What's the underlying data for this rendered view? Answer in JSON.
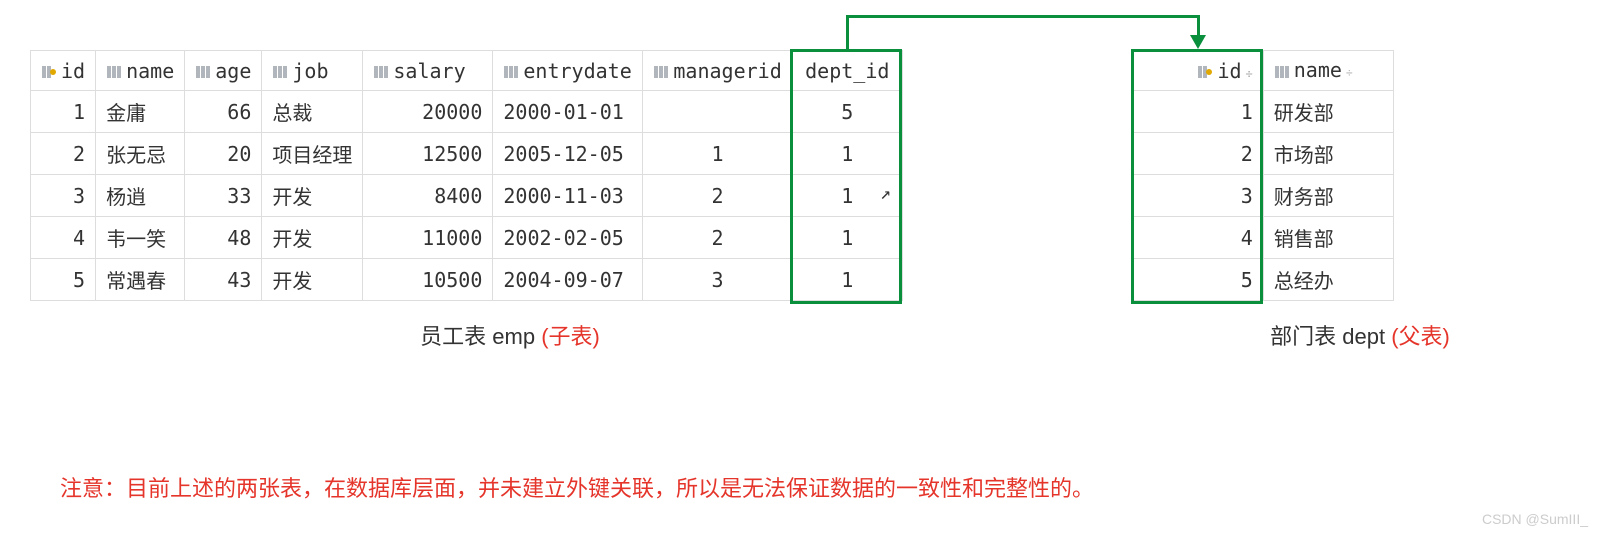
{
  "emp_table": {
    "headers": {
      "id": "id",
      "name": "name",
      "age": "age",
      "job": "job",
      "salary": "salary",
      "entrydate": "entrydate",
      "managerid": "managerid",
      "dept_id": "dept_id"
    },
    "rows": [
      {
        "id": "1",
        "name": "金庸",
        "age": "66",
        "job": "总裁",
        "salary": "20000",
        "entrydate": "2000-01-01",
        "managerid": "<null>",
        "managerid_is_null": true,
        "dept_id": "5"
      },
      {
        "id": "2",
        "name": "张无忌",
        "age": "20",
        "job": "项目经理",
        "salary": "12500",
        "entrydate": "2005-12-05",
        "managerid": "1",
        "managerid_is_null": false,
        "dept_id": "1"
      },
      {
        "id": "3",
        "name": "杨逍",
        "age": "33",
        "job": "开发",
        "salary": "8400",
        "entrydate": "2000-11-03",
        "managerid": "2",
        "managerid_is_null": false,
        "dept_id": "1"
      },
      {
        "id": "4",
        "name": "韦一笑",
        "age": "48",
        "job": "开发",
        "salary": "11000",
        "entrydate": "2002-02-05",
        "managerid": "2",
        "managerid_is_null": false,
        "dept_id": "1"
      },
      {
        "id": "5",
        "name": "常遇春",
        "age": "43",
        "job": "开发",
        "salary": "10500",
        "entrydate": "2004-09-07",
        "managerid": "3",
        "managerid_is_null": false,
        "dept_id": "1"
      }
    ]
  },
  "dept_table": {
    "headers": {
      "id": "id",
      "name": "name"
    },
    "rows": [
      {
        "id": "1",
        "name": "研发部"
      },
      {
        "id": "2",
        "name": "市场部"
      },
      {
        "id": "3",
        "name": "财务部"
      },
      {
        "id": "4",
        "name": "销售部"
      },
      {
        "id": "5",
        "name": "总经办"
      }
    ]
  },
  "captions": {
    "emp_prefix": "员工表 emp ",
    "emp_red": "(子表)",
    "dept_prefix": "部门表 dept ",
    "dept_red": "(父表)"
  },
  "notice": "注意：目前上述的两张表，在数据库层面，并未建立外键关联，所以是无法保证数据的一致性和完整性的。",
  "watermark": "CSDN @SumIII_",
  "sort_glyph": "÷",
  "icons": {
    "pk": "pk",
    "col": "col"
  }
}
